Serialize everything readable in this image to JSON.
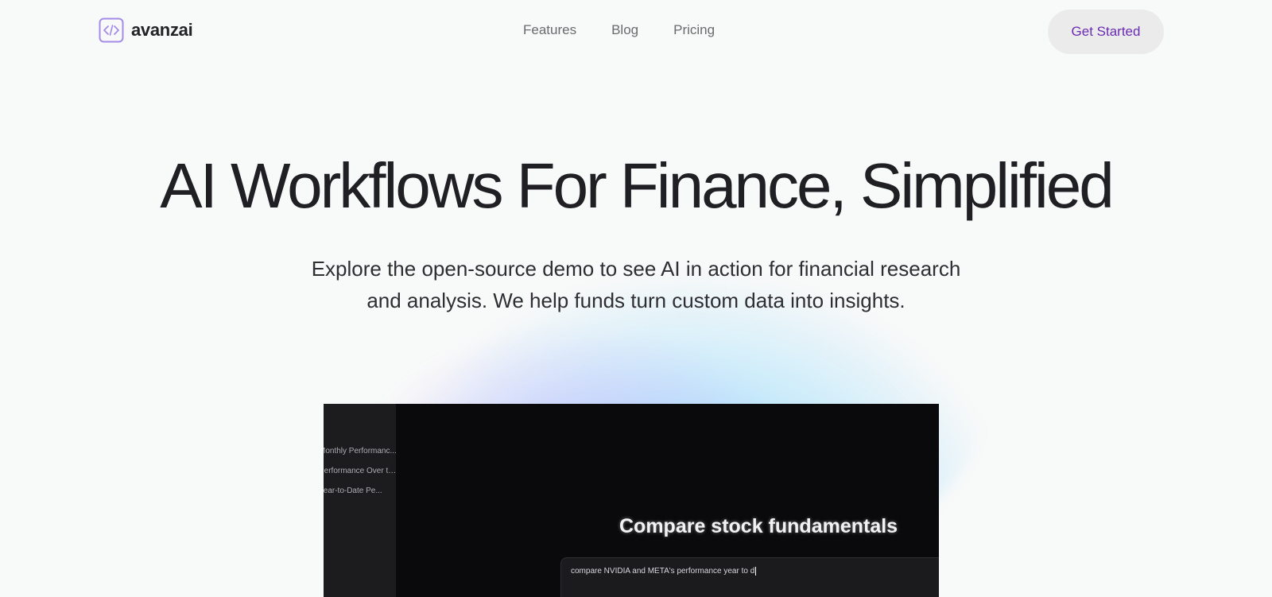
{
  "brand": {
    "name": "avanzai",
    "icon": "code-brackets-icon",
    "accent": "#6b2bb3"
  },
  "nav": {
    "links": [
      "Features",
      "Blog",
      "Pricing"
    ],
    "cta_label": "Get Started"
  },
  "hero": {
    "title": "AI Workflows For Finance, Simplified",
    "subtitle_line1": "Explore the open-source demo to see AI in action for financial research",
    "subtitle_line2": "and analysis. We help funds turn custom data into insights."
  },
  "demo": {
    "sidebar_items": [
      "Monthly Performanc...",
      "Performance Over the Pa...",
      "Year-to-Date Pe..."
    ],
    "heading": "Compare stock fundamentals",
    "input_value": "compare NVIDIA and META's performance year to d"
  }
}
